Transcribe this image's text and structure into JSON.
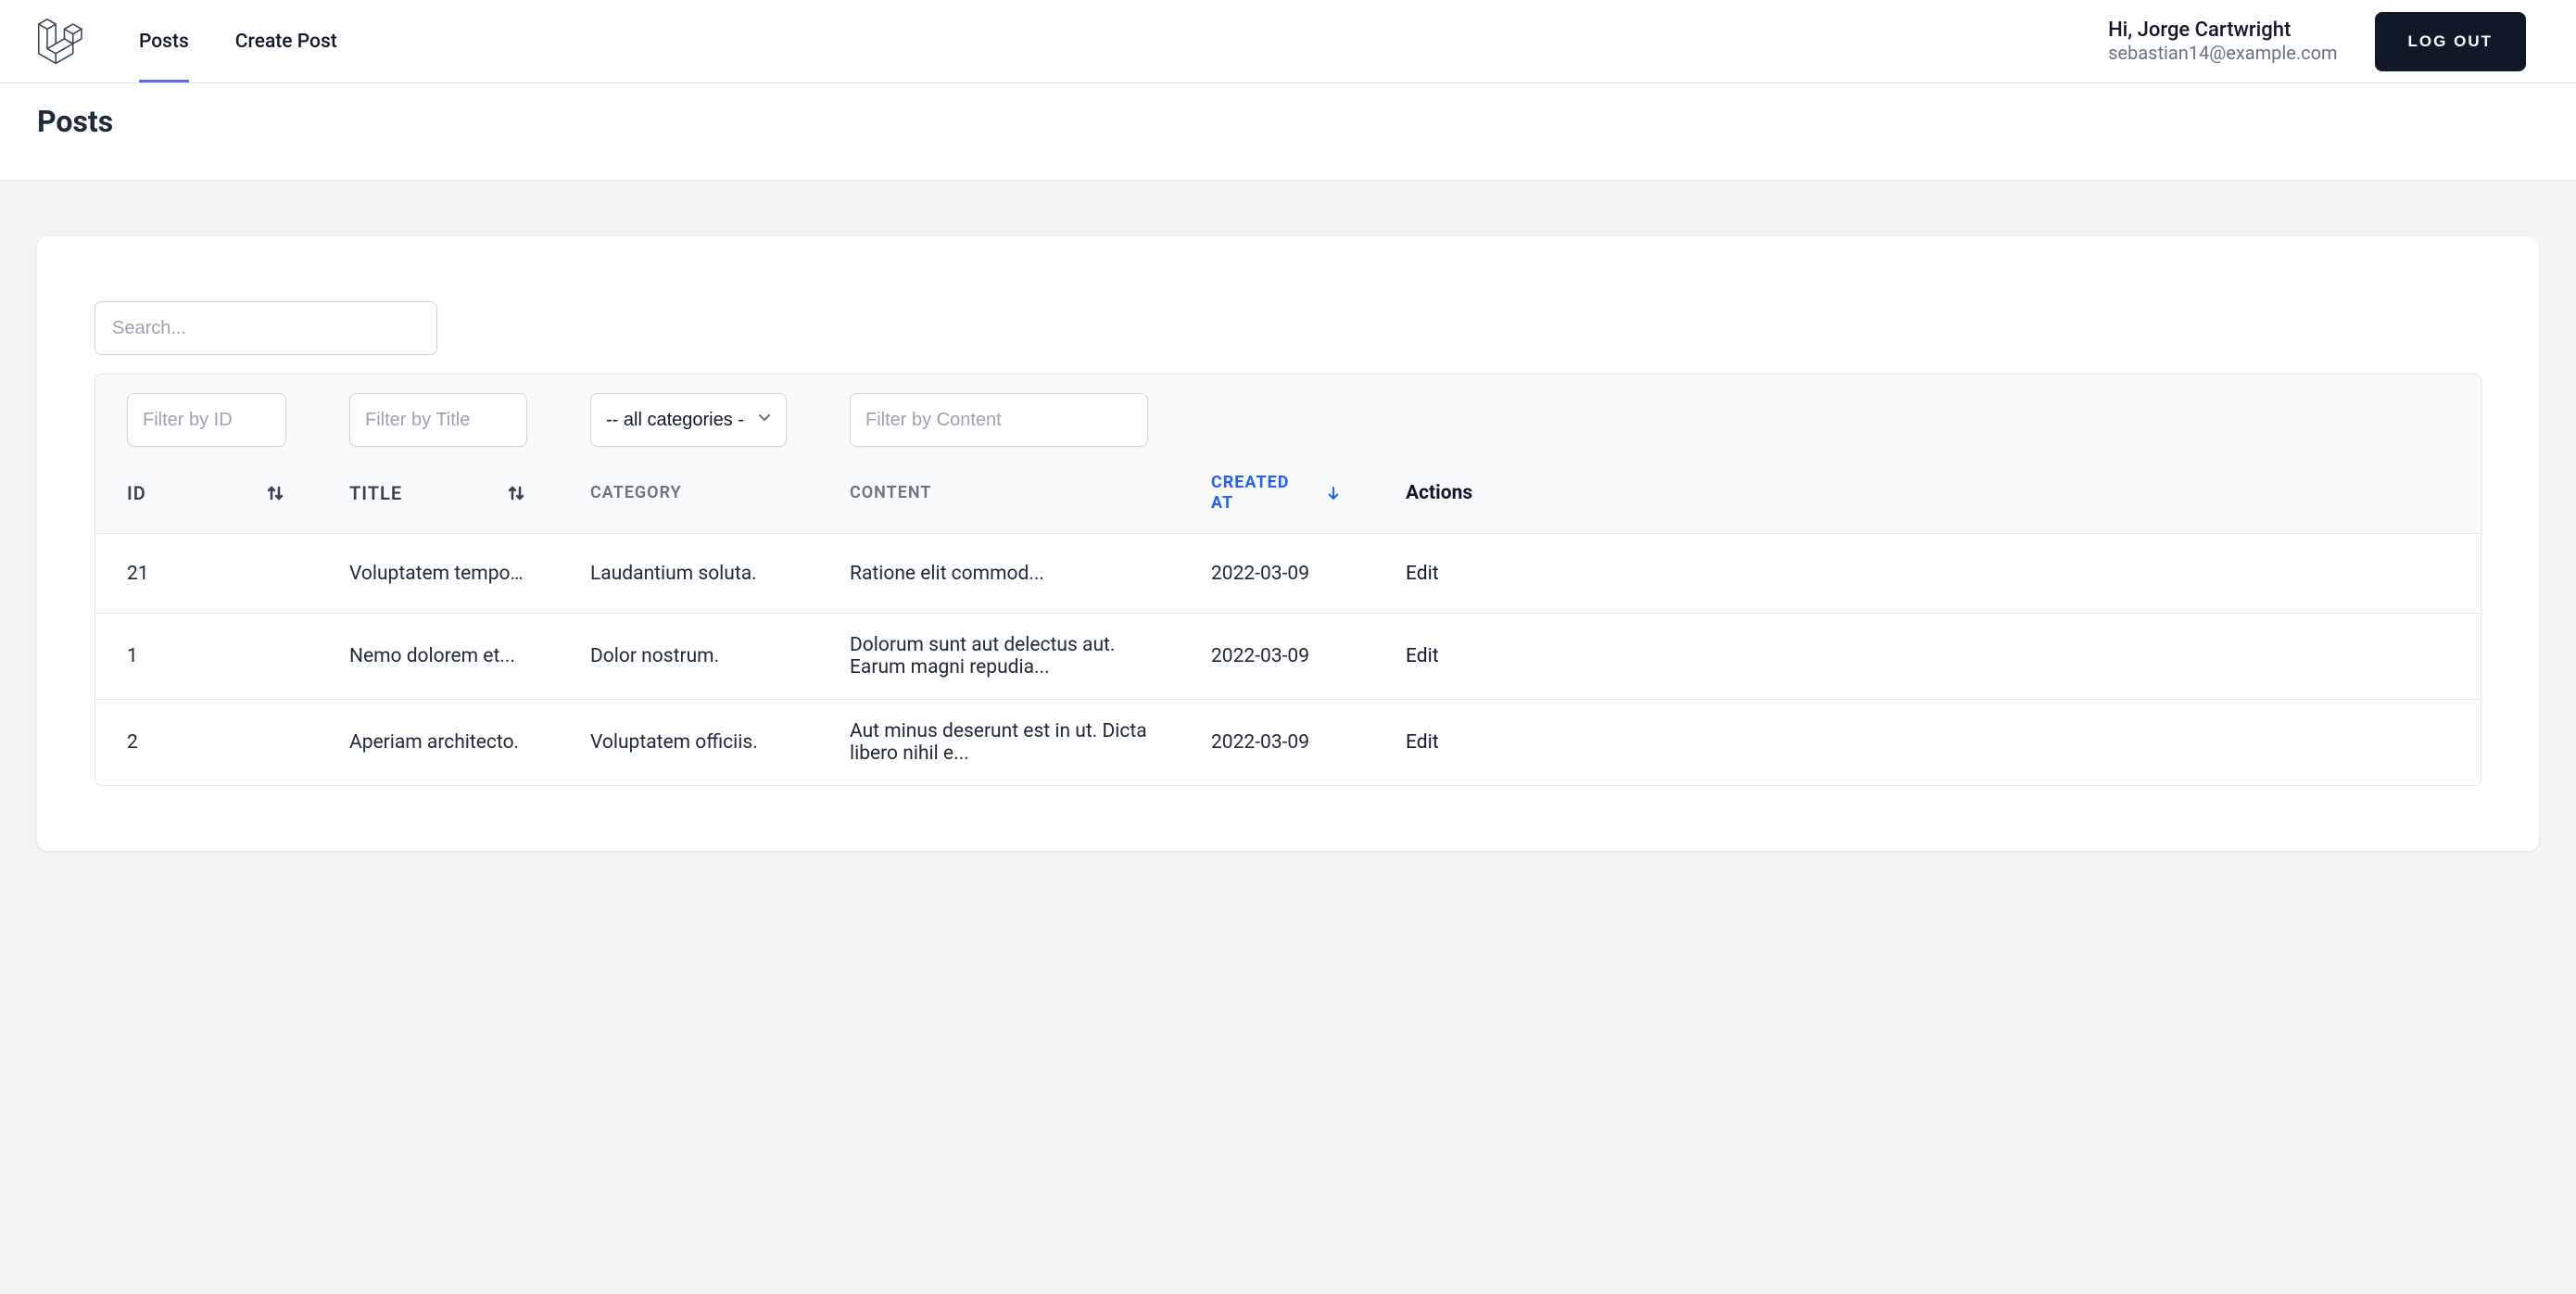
{
  "nav": {
    "links": [
      {
        "label": "Posts",
        "name": "nav-posts",
        "active": true
      },
      {
        "label": "Create Post",
        "name": "nav-create-post",
        "active": false
      }
    ],
    "greeting": "Hi, Jorge Cartwright",
    "email": "sebastian14@example.com",
    "logout_label": "LOG OUT"
  },
  "page": {
    "title": "Posts"
  },
  "search": {
    "placeholder": "Search..."
  },
  "filters": {
    "id_placeholder": "Filter by ID",
    "title_placeholder": "Filter by Title",
    "category_selected": "-- all categories --",
    "content_placeholder": "Filter by Content"
  },
  "columns": {
    "id": "ID",
    "title": "TITLE",
    "category": "CATEGORY",
    "content": "CONTENT",
    "created_at": "CREATED AT",
    "actions": "Actions"
  },
  "rows": [
    {
      "id": "21",
      "title": "Voluptatem temporibu",
      "category": "Laudantium soluta.",
      "content": "Ratione elit commod...",
      "created_at": "2022-03-09",
      "action_label": "Edit"
    },
    {
      "id": "1",
      "title": "Nemo dolorem et...",
      "category": "Dolor nostrum.",
      "content": "Dolorum sunt aut delectus aut. Earum magni repudia...",
      "created_at": "2022-03-09",
      "action_label": "Edit"
    },
    {
      "id": "2",
      "title": "Aperiam architecto.",
      "category": "Voluptatem officiis.",
      "content": "Aut minus deserunt est in ut. Dicta libero nihil e...",
      "created_at": "2022-03-09",
      "action_label": "Edit"
    }
  ]
}
